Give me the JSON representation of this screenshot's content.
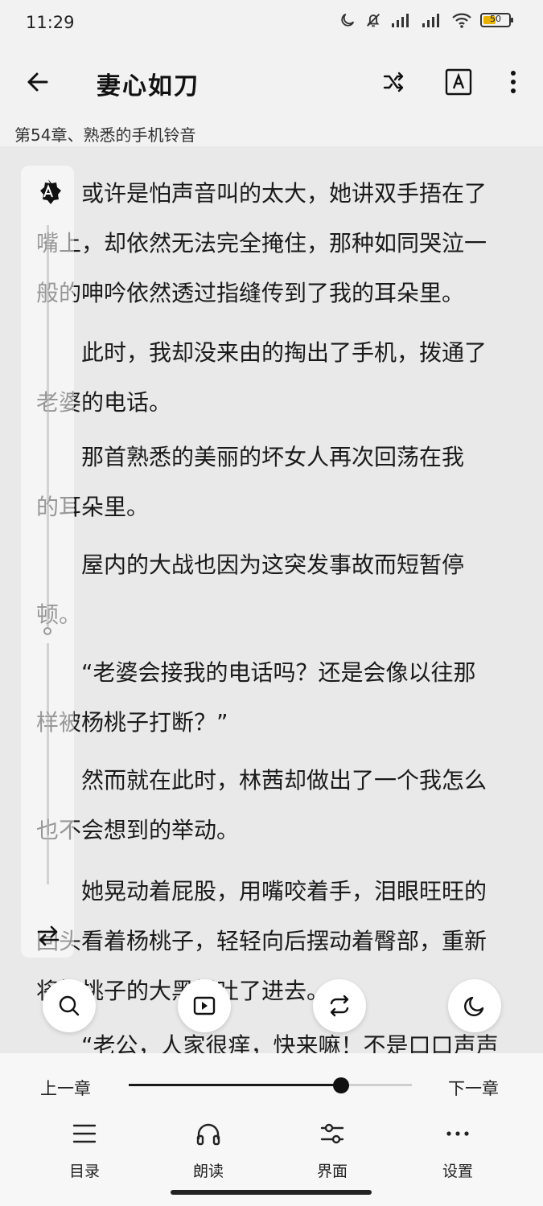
{
  "status_bar": {
    "time": "11:29",
    "battery": "50",
    "battery_fraction": 0.5
  },
  "header": {
    "title": "妻心如刀"
  },
  "chapter": {
    "title": "第54章、熟悉的手机铃音"
  },
  "paragraphs": [
    {
      "lines": [
        "或许是怕声音叫的太大，她讲双手捂在了",
        "嘴上，却依然无法完全掩住，那种如同哭泣一",
        "般的呻吟依然透过指缝传到了我的耳朵里。"
      ]
    },
    {
      "lines": [
        "此时，我却没来由的掏出了手机，拨通了",
        "老婆的电话。"
      ]
    },
    {
      "lines": [
        "那首熟悉的美丽的坏女人再次回荡在我",
        "的耳朵里。"
      ]
    },
    {
      "lines": [
        "屋内的大战也因为这突发事故而短暂停",
        "顿。"
      ]
    },
    {
      "lines": [
        "“老婆会接我的电话吗？还是会像以往那",
        "样被杨桃子打断？”"
      ]
    },
    {
      "lines": [
        "然而就在此时，林茜却做出了一个我怎么",
        "也不会想到的举动。"
      ]
    },
    {
      "lines": [
        "她晃动着屁股，用嘴咬着手，泪眼旺旺的",
        "回头看着杨桃子，轻轻向后摆动着臀部，重新",
        "将杨桃子的大黑根吐了进去。"
      ]
    },
    {
      "lines": [
        "“老公，人家很痒，快来嘛！不是口口声声"
      ]
    }
  ],
  "reader_controls": {
    "prev_chapter": "上一章",
    "next_chapter": "下一章",
    "progress": 0.75
  },
  "bottom_nav": [
    {
      "label": "目录",
      "icon": "menu-icon"
    },
    {
      "label": "朗读",
      "icon": "headphones-icon"
    },
    {
      "label": "界面",
      "icon": "sliders-icon"
    },
    {
      "label": "设置",
      "icon": "more-horizontal-icon"
    }
  ],
  "colors": {
    "background": "#e9e9e9",
    "panel": "#f7f7f7",
    "accent": "#111111"
  }
}
